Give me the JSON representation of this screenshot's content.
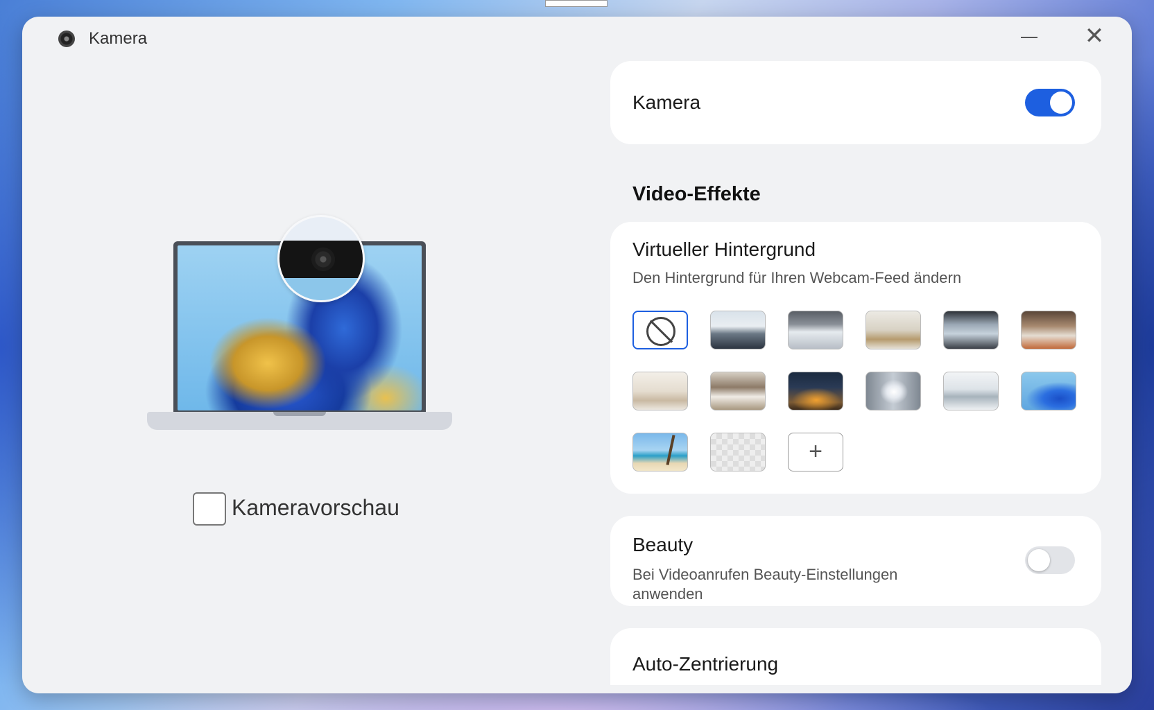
{
  "window": {
    "title": "Kamera"
  },
  "preview": {
    "checkbox_label": "Kameravorschau",
    "checked": false
  },
  "camera_card": {
    "title": "Kamera",
    "enabled": true
  },
  "video_effects": {
    "heading": "Video-Effekte"
  },
  "virtual_background": {
    "title": "Virtueller Hintergrund",
    "subtitle": "Den Hintergrund für Ihren Webcam-Feed ändern",
    "selected": "none",
    "options": [
      {
        "name": "none",
        "icon": "no-background-icon"
      },
      {
        "name": "office-1"
      },
      {
        "name": "office-2"
      },
      {
        "name": "office-3"
      },
      {
        "name": "office-4"
      },
      {
        "name": "office-5"
      },
      {
        "name": "living-room-1"
      },
      {
        "name": "living-room-2"
      },
      {
        "name": "city-night"
      },
      {
        "name": "tunnel"
      },
      {
        "name": "mountains"
      },
      {
        "name": "wallpaper-blue"
      },
      {
        "name": "beach"
      },
      {
        "name": "transparent"
      },
      {
        "name": "add",
        "icon": "plus-icon",
        "label": "+"
      }
    ]
  },
  "beauty": {
    "title": "Beauty",
    "subtitle_line1": "Bei Videoanrufen Beauty-Einstellungen",
    "subtitle_line2": "anwenden",
    "enabled": false
  },
  "auto_center": {
    "title": "Auto-Zentrierung"
  },
  "colors": {
    "accent": "#1d5fe0",
    "window_bg": "#f1f2f4",
    "card_bg": "#ffffff"
  }
}
